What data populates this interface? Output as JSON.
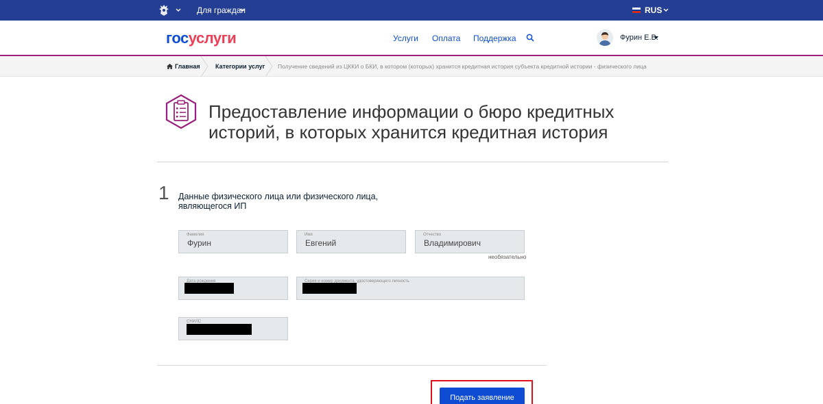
{
  "topbar": {
    "audience_label": "Для граждан",
    "language_label": "RUS",
    "flag_colors": [
      "#ffffff",
      "#0039a6",
      "#d52b1e"
    ]
  },
  "header": {
    "logo_part1": "гос",
    "logo_part2": "услуги",
    "nav": [
      "Услуги",
      "Оплата",
      "Поддержка"
    ],
    "user_name": "Фурин Е.В."
  },
  "breadcrumb": {
    "home": "Главная",
    "category": "Категории услуг",
    "current": "Получение сведений из ЦККИ о БКИ, в котором (которых) хранится кредитная история субъекта кредитной истории - физического лица"
  },
  "page": {
    "title": "Предоставление информации о бюро кредитных историй, в которых хранится кредитная история"
  },
  "section": {
    "number": "1",
    "title": "Данные физического лица или физического лица, являющегося ИП",
    "fields": {
      "last_name": {
        "label": "Фамилия",
        "value": "Фурин"
      },
      "first_name": {
        "label": "Имя",
        "value": "Евгений"
      },
      "patronymic": {
        "label": "Отчество",
        "value": "Владимирович",
        "note": "необязательно"
      },
      "birth_date": {
        "label": "Дата рождения"
      },
      "document": {
        "label": "Серия и номер документа, удостоверяющего личность"
      },
      "snils": {
        "label": "СНИЛС"
      }
    }
  },
  "actions": {
    "submit_label": "Подать заявление"
  },
  "colors": {
    "topbar": "#233e92",
    "accent_purple": "#9b1e7c",
    "link_blue": "#0d4cd3",
    "logo_red": "#ee3f58",
    "highlight_red": "#e10e1e"
  }
}
